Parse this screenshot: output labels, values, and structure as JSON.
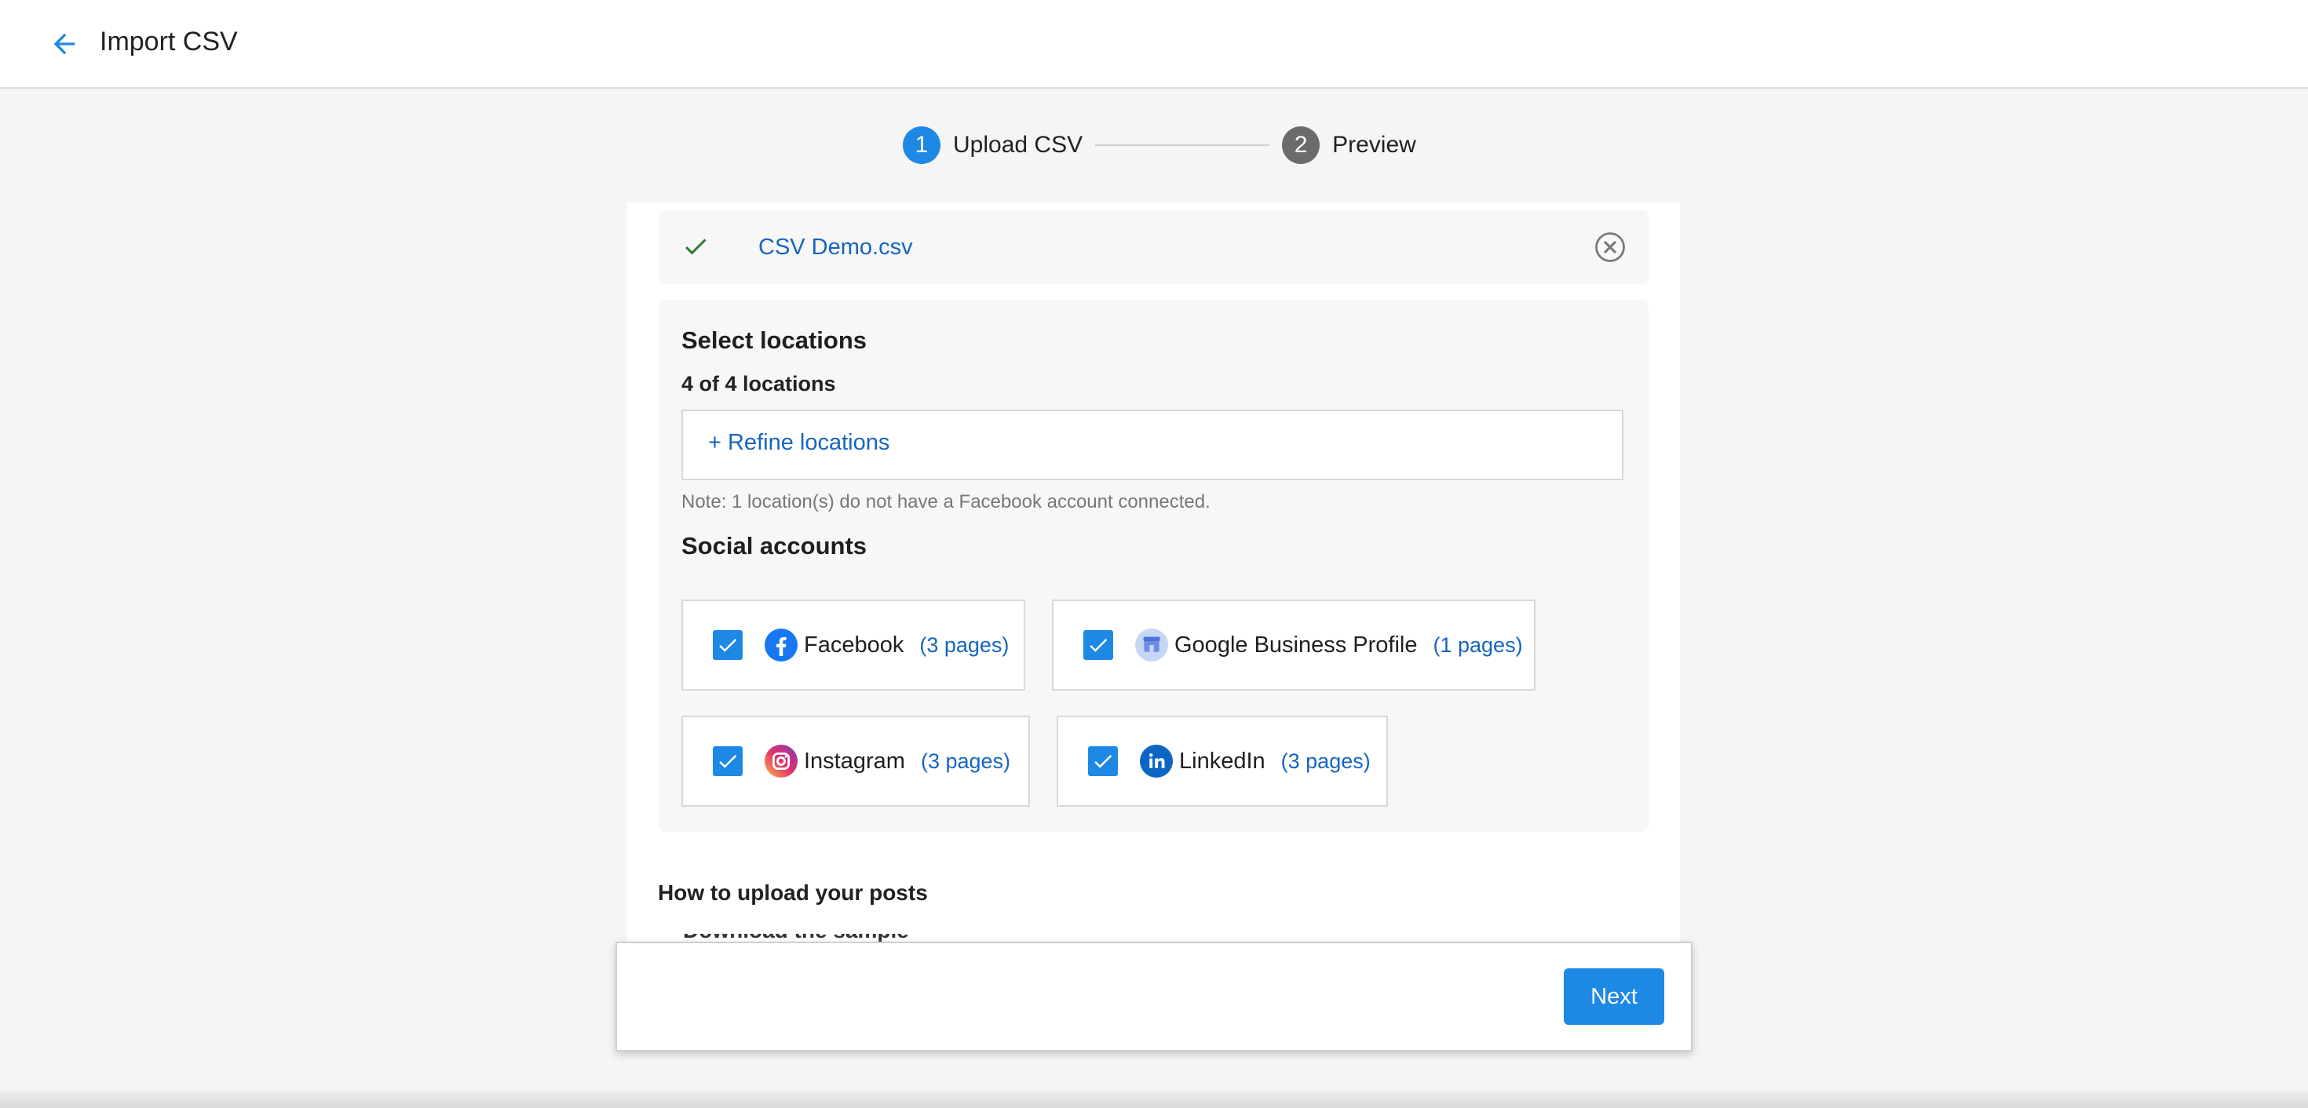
{
  "header": {
    "title": "Import CSV",
    "back_icon": "arrow-left-icon"
  },
  "stepper": {
    "steps": [
      {
        "number": "1",
        "label": "Upload CSV",
        "state": "active"
      },
      {
        "number": "2",
        "label": "Preview",
        "state": "inactive"
      }
    ]
  },
  "file": {
    "name": "CSV Demo.csv",
    "status_icon": "check-icon",
    "remove_icon": "close-circle-icon"
  },
  "locations": {
    "title": "Select locations",
    "count_text": "4 of 4 locations",
    "refine_label": "+ Refine locations",
    "note": "Note: 1 location(s) do not have a Facebook account connected."
  },
  "social": {
    "title": "Social accounts",
    "accounts": [
      {
        "name": "Facebook",
        "pages": "(3 pages)",
        "checked": true,
        "icon": "facebook-icon"
      },
      {
        "name": "Google Business Profile",
        "pages": "(1 pages)",
        "checked": true,
        "icon": "google-business-icon"
      },
      {
        "name": "Instagram",
        "pages": "(3 pages)",
        "checked": true,
        "icon": "instagram-icon"
      },
      {
        "name": "LinkedIn",
        "pages": "(3 pages)",
        "checked": true,
        "icon": "linkedin-icon"
      }
    ]
  },
  "howto": {
    "title": "How to upload your posts",
    "partial_text": "Download the sample file"
  },
  "footer": {
    "next_label": "Next"
  },
  "colors": {
    "accent": "#1e88e5",
    "link": "#1565c0",
    "success": "#2e7d32"
  }
}
